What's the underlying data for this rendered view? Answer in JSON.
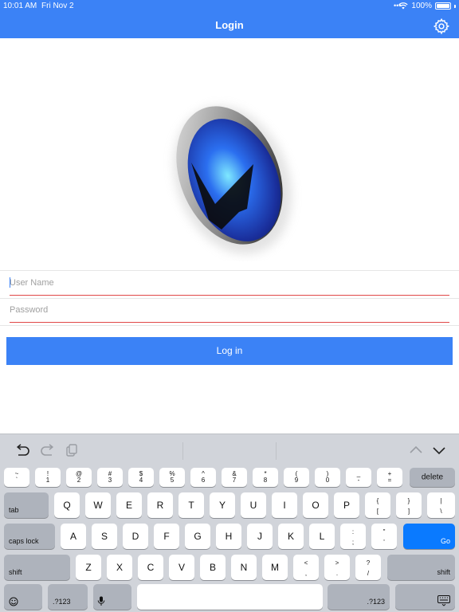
{
  "status_bar": {
    "time": "10:01 AM",
    "date": "Fri Nov 2",
    "battery": "100%"
  },
  "header": {
    "title": "Login"
  },
  "form": {
    "username_placeholder": "User Name",
    "password_placeholder": "Password",
    "login_label": "Log in"
  },
  "colors": {
    "accent": "#3b82f6",
    "underline": "#e04848",
    "go_key": "#0a7aff"
  },
  "icons": [
    "wifi-icon",
    "battery-icon",
    "gear-icon",
    "undo-icon",
    "redo-icon",
    "paste-icon",
    "chevron-up-icon",
    "chevron-down-icon",
    "emoji-icon",
    "microphone-icon",
    "keyboard-dismiss-icon"
  ],
  "keyboard": {
    "number_row": [
      {
        "top": "~",
        "bottom": "`"
      },
      {
        "top": "!",
        "bottom": "1"
      },
      {
        "top": "@",
        "bottom": "2"
      },
      {
        "top": "#",
        "bottom": "3"
      },
      {
        "top": "$",
        "bottom": "4"
      },
      {
        "top": "%",
        "bottom": "5"
      },
      {
        "top": "^",
        "bottom": "6"
      },
      {
        "top": "&",
        "bottom": "7"
      },
      {
        "top": "*",
        "bottom": "8"
      },
      {
        "top": "(",
        "bottom": "9"
      },
      {
        "top": ")",
        "bottom": "0"
      },
      {
        "top": "_",
        "bottom": "-"
      },
      {
        "top": "+",
        "bottom": "="
      }
    ],
    "delete_label": "delete",
    "tab_label": "tab",
    "qwerty_row": [
      "Q",
      "W",
      "E",
      "R",
      "T",
      "Y",
      "U",
      "I",
      "O",
      "P"
    ],
    "qwerty_symbols": [
      {
        "top": "{",
        "bottom": "["
      },
      {
        "top": "}",
        "bottom": "]"
      },
      {
        "top": "|",
        "bottom": "\\"
      }
    ],
    "caps_label": "caps lock",
    "home_row": [
      "A",
      "S",
      "D",
      "F",
      "G",
      "H",
      "J",
      "K",
      "L"
    ],
    "home_symbols": [
      {
        "top": ":",
        "bottom": ";"
      },
      {
        "top": "\"",
        "bottom": "'"
      }
    ],
    "go_label": "Go",
    "shift_label": "shift",
    "bottom_row": [
      "Z",
      "X",
      "C",
      "V",
      "B",
      "N",
      "M"
    ],
    "bottom_symbols": [
      {
        "top": "<",
        "bottom": ","
      },
      {
        "top": ">",
        "bottom": "."
      },
      {
        "top": "?",
        "bottom": "/"
      }
    ],
    "numbers_label": ".?123"
  }
}
